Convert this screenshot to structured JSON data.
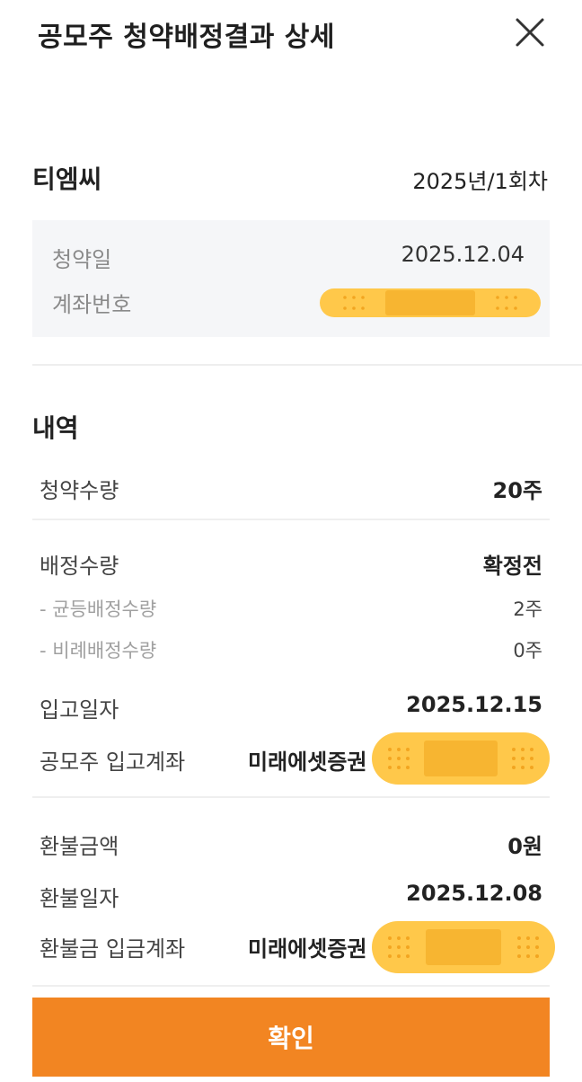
{
  "header": {
    "title": "공모주 청약배정결과 상세"
  },
  "summary": {
    "company": "티엠씨",
    "round": "2025년/1회차"
  },
  "info": {
    "subscription_date_label": "청약일",
    "subscription_date": "2025.12.04",
    "account_label": "계좌번호"
  },
  "details": {
    "title": "내역",
    "subscribed_qty_label": "청약수량",
    "subscribed_qty": "20주",
    "allotted_qty_label": "배정수량",
    "allotted_qty": "확정전",
    "equal_qty_label": "- 균등배정수량",
    "equal_qty": "2주",
    "proportional_qty_label": "- 비례배정수량",
    "proportional_qty": "0주",
    "deposit_date_label": "입고일자",
    "deposit_date": "2025.12.15",
    "deposit_account_label": "공모주 입고계좌",
    "deposit_account_broker": "미래에셋증권",
    "refund_amount_label": "환불금액",
    "refund_amount": "0원",
    "refund_date_label": "환불일자",
    "refund_date": "2025.12.08",
    "refund_account_label": "환불금 입금계좌",
    "refund_account_broker": "미래에셋증권"
  },
  "confirm_button": {
    "label": "확인"
  },
  "colors": {
    "accent": "#f28522",
    "redaction": "#ffc84a"
  }
}
